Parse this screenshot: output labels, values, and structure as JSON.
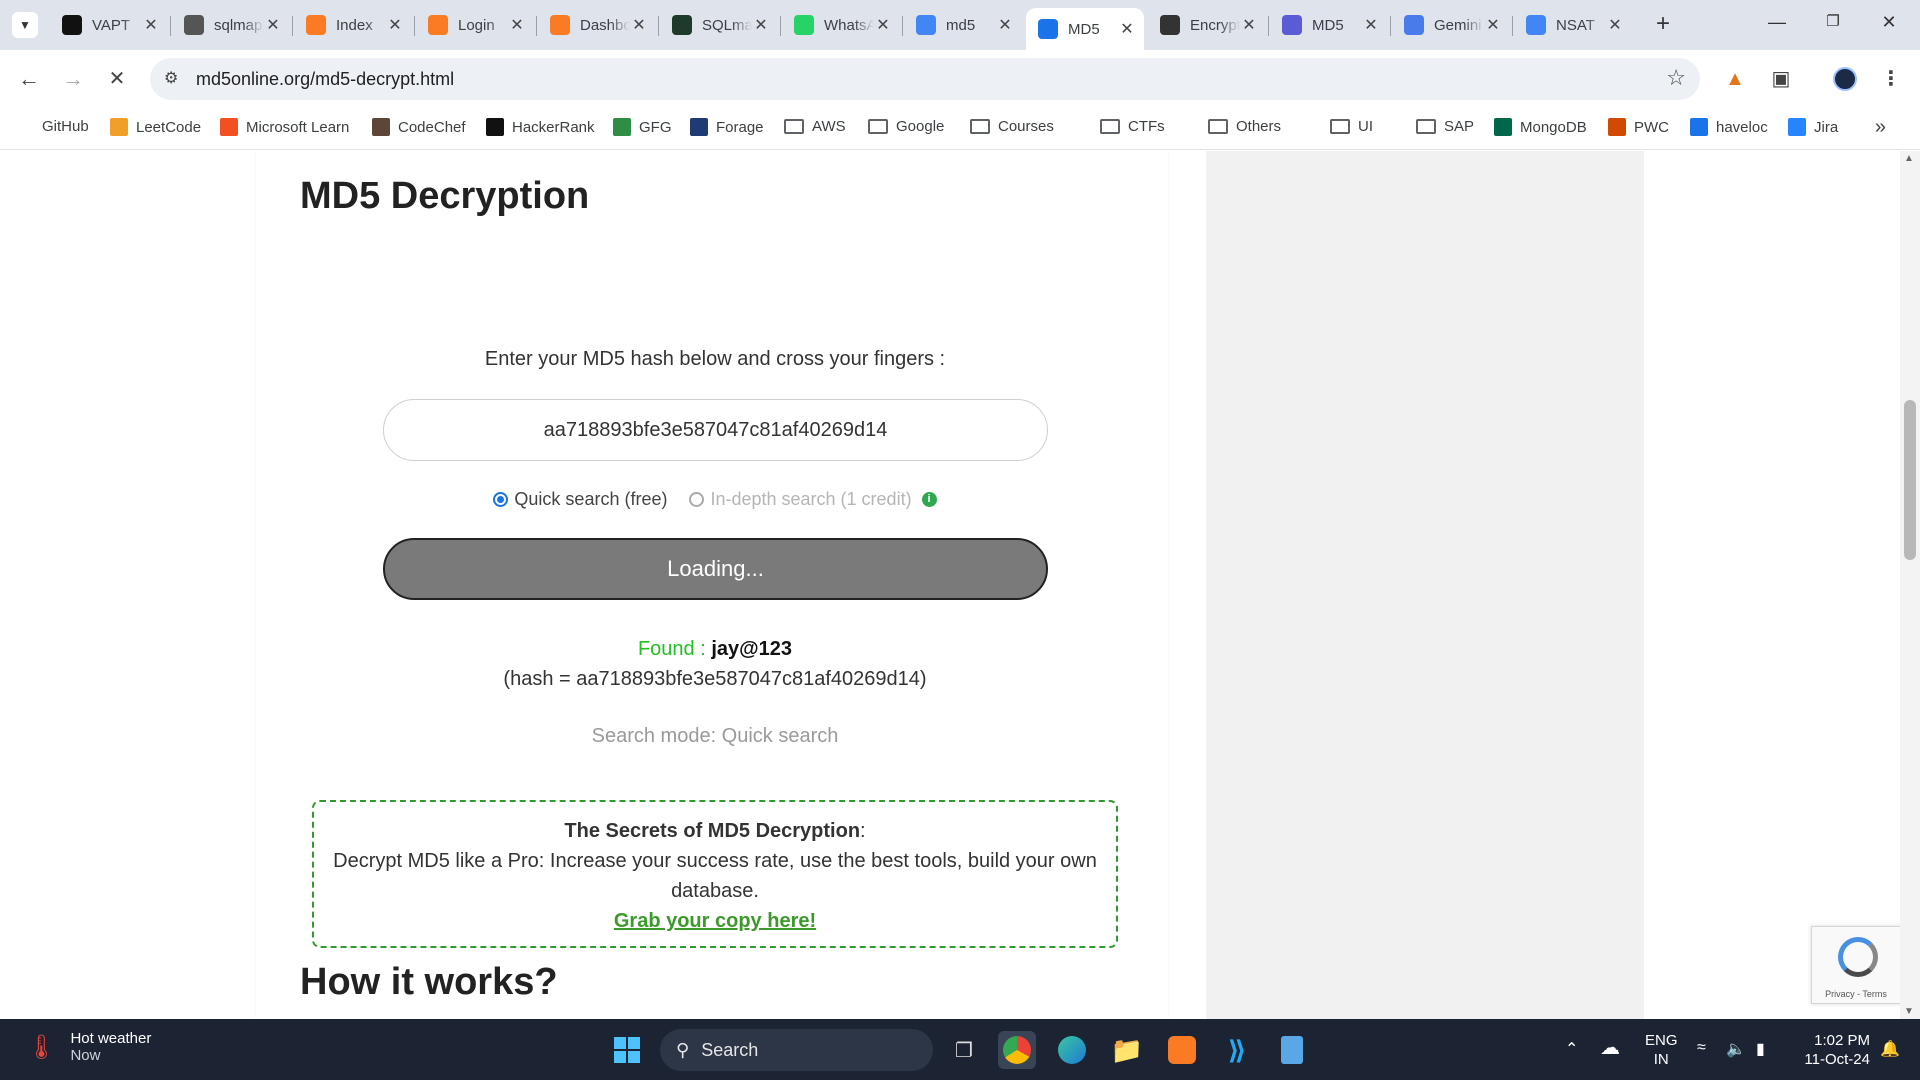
{
  "browser": {
    "tabs": [
      {
        "title": "VAPT",
        "favicon": "chatgpt-icon",
        "color": "#111111"
      },
      {
        "title": "sqlmap",
        "favicon": "sqlmap-icon",
        "color": "#555555"
      },
      {
        "title": "Index",
        "favicon": "xampp-icon",
        "color": "#fb7a24"
      },
      {
        "title": "Login",
        "favicon": "xampp-icon",
        "color": "#fb7a24"
      },
      {
        "title": "Dashboard",
        "favicon": "xampp-icon",
        "color": "#fb7a24"
      },
      {
        "title": "SQLmap",
        "favicon": "terminal-icon",
        "color": "#1e3a2a"
      },
      {
        "title": "WhatsApp",
        "favicon": "whatsapp-icon",
        "color": "#25d366"
      },
      {
        "title": "md5",
        "favicon": "google-icon",
        "color": "#4285f4"
      },
      {
        "title": "MD5",
        "favicon": "md5online-icon",
        "color": "#1a73e8",
        "active": true
      },
      {
        "title": "Encrypt",
        "favicon": "lock-search-icon",
        "color": "#333333"
      },
      {
        "title": "MD5",
        "favicon": "hexagon-icon",
        "color": "#5b5bd6"
      },
      {
        "title": "Gemini",
        "favicon": "gemini-icon",
        "color": "#4a7bea"
      },
      {
        "title": "NSAT",
        "favicon": "google-icon",
        "color": "#4285f4"
      }
    ],
    "url": "md5online.org/md5-decrypt.html",
    "bookmarks": [
      {
        "label": "GitHub",
        "icon": "github-icon",
        "color": "#111111"
      },
      {
        "label": "LeetCode",
        "icon": "leetcode-icon",
        "color": "#f0a028"
      },
      {
        "label": "Microsoft Learn",
        "icon": "microsoft-icon",
        "color": "#f25022"
      },
      {
        "label": "CodeChef",
        "icon": "codechef-icon",
        "color": "#5b4638"
      },
      {
        "label": "HackerRank",
        "icon": "hackerrank-icon",
        "color": "#111111"
      },
      {
        "label": "GFG",
        "icon": "gfg-icon",
        "color": "#2f8d46"
      },
      {
        "label": "Forage",
        "icon": "forage-icon",
        "color": "#1f3b73"
      },
      {
        "label": "AWS",
        "icon": "folder-icon"
      },
      {
        "label": "Google",
        "icon": "folder-icon"
      },
      {
        "label": "Courses",
        "icon": "folder-icon"
      },
      {
        "label": "CTFs",
        "icon": "folder-icon"
      },
      {
        "label": "Others",
        "icon": "folder-icon"
      },
      {
        "label": "UI",
        "icon": "folder-icon"
      },
      {
        "label": "SAP",
        "icon": "folder-icon"
      },
      {
        "label": "MongoDB",
        "icon": "mongodb-icon",
        "color": "#00684a"
      },
      {
        "label": "PWC",
        "icon": "pwc-icon",
        "color": "#d04a02"
      },
      {
        "label": "haveloc",
        "icon": "haveloc-icon",
        "color": "#1a73e8"
      },
      {
        "label": "Jira",
        "icon": "jira-icon",
        "color": "#2684ff"
      }
    ]
  },
  "page": {
    "title": "MD5 Decryption",
    "prompt": "Enter your MD5 hash below and cross your fingers :",
    "hash_value": "aa718893bfe3e587047c81af40269d14",
    "mode_quick": "Quick search (free)",
    "mode_deep": "In-depth search (1 credit)",
    "button_label": "Loading...",
    "found_label": "Found :",
    "found_value": "jay@123",
    "hash_line": "(hash = aa718893bfe3e587047c81af40269d14)",
    "search_mode": "Search mode: Quick search",
    "promo_title": "The Secrets of MD5 Decryption",
    "promo_text": "Decrypt MD5 like a Pro: Increase your success rate, use the best tools, build your own database.",
    "promo_link": "Grab your copy here!",
    "how_title": "How it works?",
    "recaptcha_terms": "Privacy - Terms"
  },
  "taskbar": {
    "weather_title": "Hot weather",
    "weather_sub": "Now",
    "search_label": "Search",
    "lang_1": "ENG",
    "lang_2": "IN",
    "time": "1:02 PM",
    "date": "11-Oct-24"
  },
  "colors": {
    "found_green": "#21c021",
    "promo_border": "#2e9b2e",
    "button_gray": "#7a7a7a",
    "taskbar_bg": "#1c2434"
  }
}
